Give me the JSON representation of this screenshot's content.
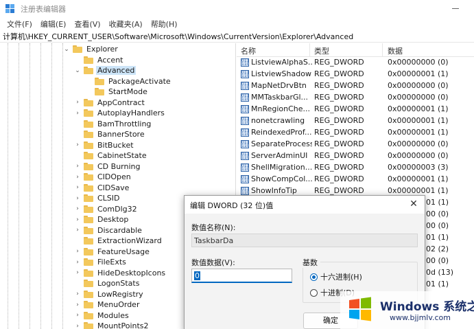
{
  "window": {
    "title": "注册表编辑器"
  },
  "menu": [
    "文件(F)",
    "编辑(E)",
    "查看(V)",
    "收藏夹(A)",
    "帮助(H)"
  ],
  "address": "计算机\\HKEY_CURRENT_USER\\Software\\Microsoft\\Windows\\CurrentVersion\\Explorer\\Advanced",
  "tree": [
    {
      "label": "Explorer",
      "chev": "⌄",
      "selected": false
    },
    {
      "label": "Accent",
      "chev": "",
      "selected": false
    },
    {
      "label": "Advanced",
      "chev": "⌄",
      "selected": true
    },
    {
      "label": "PackageActivate",
      "chev": "",
      "selected": false
    },
    {
      "label": "StartMode",
      "chev": "",
      "selected": false
    },
    {
      "label": "AppContract",
      "chev": "›",
      "selected": false
    },
    {
      "label": "AutoplayHandlers",
      "chev": "›",
      "selected": false
    },
    {
      "label": "BamThrottling",
      "chev": "",
      "selected": false
    },
    {
      "label": "BannerStore",
      "chev": "",
      "selected": false
    },
    {
      "label": "BitBucket",
      "chev": "›",
      "selected": false
    },
    {
      "label": "CabinetState",
      "chev": "",
      "selected": false
    },
    {
      "label": "CD Burning",
      "chev": "›",
      "selected": false
    },
    {
      "label": "CIDOpen",
      "chev": "›",
      "selected": false
    },
    {
      "label": "CIDSave",
      "chev": "›",
      "selected": false
    },
    {
      "label": "CLSID",
      "chev": "›",
      "selected": false
    },
    {
      "label": "ComDlg32",
      "chev": "›",
      "selected": false
    },
    {
      "label": "Desktop",
      "chev": "›",
      "selected": false
    },
    {
      "label": "Discardable",
      "chev": "›",
      "selected": false
    },
    {
      "label": "ExtractionWizard",
      "chev": "",
      "selected": false
    },
    {
      "label": "FeatureUsage",
      "chev": "›",
      "selected": false
    },
    {
      "label": "FileExts",
      "chev": "›",
      "selected": false
    },
    {
      "label": "HideDesktopIcons",
      "chev": "›",
      "selected": false
    },
    {
      "label": "LogonStats",
      "chev": "",
      "selected": false
    },
    {
      "label": "LowRegistry",
      "chev": "›",
      "selected": false
    },
    {
      "label": "MenuOrder",
      "chev": "›",
      "selected": false
    },
    {
      "label": "Modules",
      "chev": "›",
      "selected": false
    },
    {
      "label": "MountPoints2",
      "chev": "›",
      "selected": false
    }
  ],
  "list": {
    "headers": {
      "name": "名称",
      "type": "类型",
      "data": "数据"
    },
    "rows": [
      {
        "name": "ListviewAlphaS...",
        "type": "REG_DWORD",
        "data": "0x00000000 (0)"
      },
      {
        "name": "ListviewShadow",
        "type": "REG_DWORD",
        "data": "0x00000001 (1)"
      },
      {
        "name": "MapNetDrvBtn",
        "type": "REG_DWORD",
        "data": "0x00000000 (0)"
      },
      {
        "name": "MMTaskbarGl...",
        "type": "REG_DWORD",
        "data": "0x00000000 (0)"
      },
      {
        "name": "MnRegionChe...",
        "type": "REG_DWORD",
        "data": "0x00000001 (1)"
      },
      {
        "name": "nonetcrawling",
        "type": "REG_DWORD",
        "data": "0x00000001 (1)"
      },
      {
        "name": "ReindexedProf...",
        "type": "REG_DWORD",
        "data": "0x00000001 (1)"
      },
      {
        "name": "SeparateProcess",
        "type": "REG_DWORD",
        "data": "0x00000000 (0)"
      },
      {
        "name": "ServerAdminUI",
        "type": "REG_DWORD",
        "data": "0x00000000 (0)"
      },
      {
        "name": "ShellMigration...",
        "type": "REG_DWORD",
        "data": "0x00000003 (3)"
      },
      {
        "name": "ShowCompCol...",
        "type": "REG_DWORD",
        "data": "0x00000001 (1)"
      },
      {
        "name": "ShowInfoTip",
        "type": "REG_DWORD",
        "data": "0x00000001 (1)"
      }
    ],
    "partial_data": [
      "01 (1)",
      "00 (0)",
      "00 (0)",
      "01 (1)",
      "02 (2)",
      "00 (0)",
      "0d (13)",
      "01 (1)"
    ]
  },
  "dialog": {
    "title": "编辑 DWORD (32 位)值",
    "close_glyph": "✕",
    "name_label": "数值名称(N):",
    "name_value": "TaskbarDa",
    "data_label": "数值数据(V):",
    "data_value": "0",
    "base_label": "基数",
    "radio_hex": "十六进制(H)",
    "radio_dec": "十进制(D)",
    "selected_base": "hex",
    "ok_label": "确定"
  },
  "watermark": {
    "title": "Windows 系统之家",
    "url": "www.bjjmlv.com",
    "colors": [
      "#f25022",
      "#7fba00",
      "#00a4ef",
      "#ffb900"
    ]
  }
}
